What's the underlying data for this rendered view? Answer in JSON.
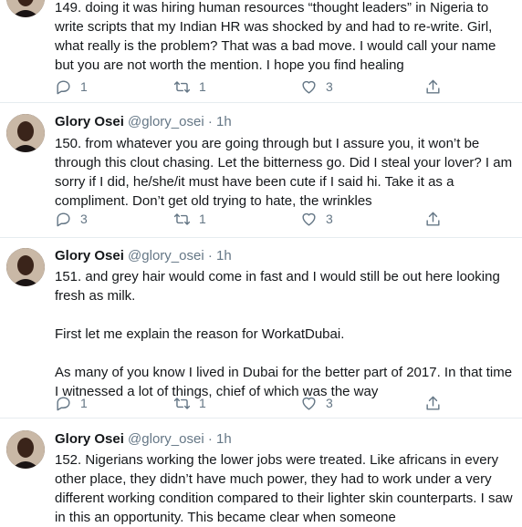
{
  "tweets": [
    {
      "show_header": false,
      "name": "",
      "handle": "",
      "time": "",
      "paragraphs": [
        "149. doing it was hiring human resources “thought leaders” in Nigeria to write scripts that my Indian HR was shocked by and had to re-write. Girl, what really is the problem? That was a bad move. I would call your name but you are not worth the mention. I hope you find healing"
      ],
      "replies": "1",
      "retweets": "1",
      "likes": "3"
    },
    {
      "show_header": true,
      "name": "Glory Osei",
      "handle": "@glory_osei",
      "dot": "·",
      "time": "1h",
      "paragraphs": [
        "150.  from whatever you are going through but I assure you, it won’t be through this clout chasing. Let the bitterness go. Did I steal your lover? I am sorry if I did, he/she/it must have been cute if I said hi. Take it as a compliment. Don’t get old trying to hate, the wrinkles"
      ],
      "replies": "3",
      "retweets": "1",
      "likes": "3"
    },
    {
      "show_header": true,
      "name": "Glory Osei",
      "handle": "@glory_osei",
      "dot": "·",
      "time": "1h",
      "paragraphs": [
        "151.  and grey hair would come in fast and I would still be out here looking fresh as milk.",
        "First let me explain the reason for WorkatDubai.",
        "As many of you know I lived in Dubai for the better part of 2017. In that time I witnessed a lot of things, chief of which was the way"
      ],
      "replies": "1",
      "retweets": "1",
      "likes": "3"
    },
    {
      "show_header": true,
      "name": "Glory Osei",
      "handle": "@glory_osei",
      "dot": "·",
      "time": "1h",
      "paragraphs": [
        "152. Nigerians working the lower jobs were treated. Like africans in every other place, they didn’t have much power, they had to work under a very different working condition compared to their lighter skin counterparts. I saw in this an opportunity. This became clear when someone"
      ],
      "replies": "",
      "retweets": "",
      "likes": ""
    }
  ],
  "icons": {
    "reply": "reply-icon",
    "retweet": "retweet-icon",
    "like": "like-icon",
    "share": "share-icon"
  },
  "colors": {
    "text": "#14171a",
    "secondary": "#657786",
    "divider": "#e6ecf0"
  }
}
